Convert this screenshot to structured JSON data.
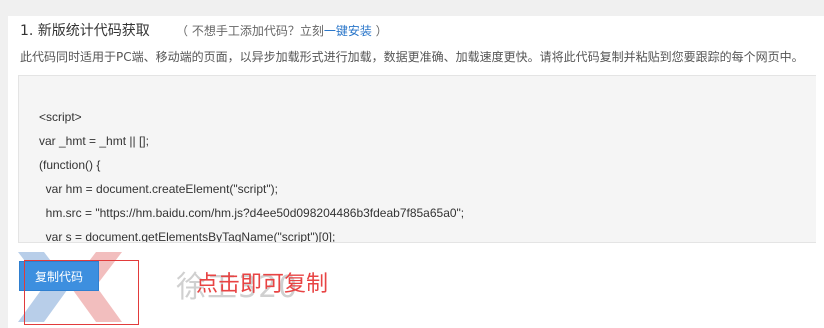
{
  "section": {
    "heading": "1. 新版统计代码获取",
    "note_prefix": "（ 不想手工添加代码？立刻",
    "note_link": "一键安装",
    "note_suffix": " ）",
    "description": "此代码同时适用于PC端、移动端的页面，以异步加载形式进行加载，数据更准确、加载速度更快。请将此代码复制并粘贴到您要跟踪的每个网页中。"
  },
  "code": {
    "lines": [
      "<script>",
      "var _hmt = _hmt || [];",
      "(function() {",
      "  var hm = document.createElement(\"script\");",
      "  hm.src = \"https://hm.baidu.com/hm.js?d4ee50d098204486b3fdeab7f85a65a0\";",
      "  var s = document.getElementsByTagName(\"script\")[0];"
    ]
  },
  "actions": {
    "copy_label": "复制代码"
  },
  "annotation": {
    "hint": "点击即可复制"
  },
  "watermark": {
    "text": "徐工320"
  },
  "colors": {
    "button": "#3d8fdf",
    "link": "#2a76c9",
    "annotation": "#e23b3b"
  }
}
